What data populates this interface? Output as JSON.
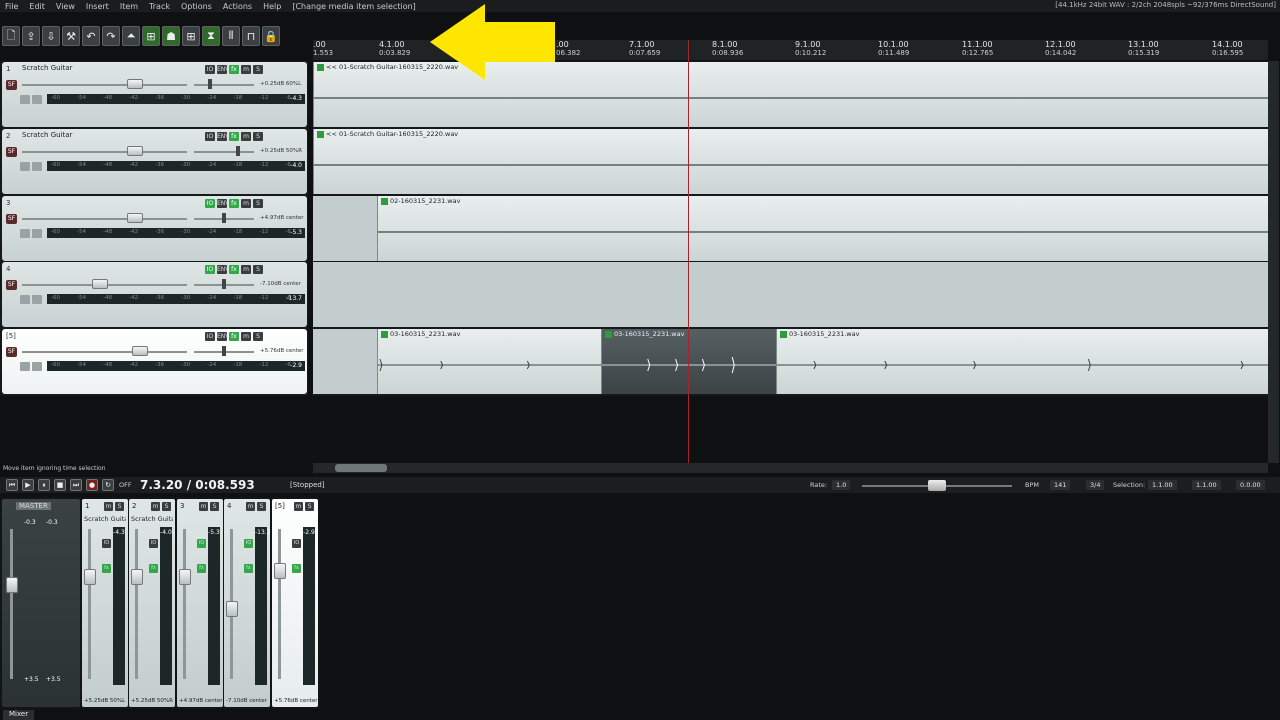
{
  "menu": [
    "File",
    "Edit",
    "View",
    "Insert",
    "Item",
    "Track",
    "Options",
    "Actions",
    "Help"
  ],
  "undo_hint": "[Change media item selection]",
  "audio_status": "[44.1kHz 24bit WAV : 2/2ch 2048spls ~92/376ms DirectSound]",
  "ruler": [
    {
      "bar": ".00",
      "time": "1.553"
    },
    {
      "bar": "4.1.00",
      "time": "0:03.829"
    },
    {
      "bar": ".00",
      "time": "06.382"
    },
    {
      "bar": "7.1.00",
      "time": "0:07.659"
    },
    {
      "bar": "8.1.00",
      "time": "0:08.936"
    },
    {
      "bar": "9.1.00",
      "time": "0:10.212"
    },
    {
      "bar": "10.1.00",
      "time": "0:11.489"
    },
    {
      "bar": "11.1.00",
      "time": "0:12.765"
    },
    {
      "bar": "12.1.00",
      "time": "0:14.042"
    },
    {
      "bar": "13.1.00",
      "time": "0:15.319"
    },
    {
      "bar": "14.1.00",
      "time": "0:16.595"
    }
  ],
  "tracks": [
    {
      "num": "1",
      "name": "Scratch Guitar",
      "vol": "+0.25dB 60%L",
      "peak": "-4.3"
    },
    {
      "num": "2",
      "name": "Scratch Guitar",
      "vol": "+0.25dB 50%R",
      "peak": "-4.0"
    },
    {
      "num": "3",
      "name": "",
      "vol": "+4.97dB center",
      "peak": "-5.3"
    },
    {
      "num": "4",
      "name": "",
      "vol": "-7.10dB center",
      "peak": "-13.7"
    },
    {
      "num": "[5]",
      "name": "",
      "vol": "+5.76dB center",
      "peak": "-2.9"
    }
  ],
  "meter_ticks": [
    "-60",
    "-54",
    "-48",
    "-42",
    "-36",
    "-30",
    "-24",
    "-18",
    "-12",
    "-6"
  ],
  "track_buttons": {
    "io": "IO",
    "env": "ENV",
    "fx": "fx",
    "mute": "m",
    "solo": "S",
    "rec": "SF"
  },
  "items": [
    {
      "label": "<< 01-Scratch Guitar-160315_2220.wav"
    },
    {
      "label": "<< 01-Scratch Guitar-160315_2220.wav"
    },
    {
      "label": "02-160315_2231.wav"
    },
    {
      "label": "03-160315_2231.wav"
    },
    {
      "label": "03-160315_2231.wav"
    },
    {
      "label": "03-160315_2231.wav"
    }
  ],
  "status_line": "Move item ignoring time selection",
  "transport": {
    "timecode": "7.3.20 / 0:08.593",
    "state": "[Stopped]",
    "off_label": "OFF",
    "rate_label": "Rate:",
    "rate": "1.0",
    "bpm_label": "BPM",
    "bpm": "141",
    "sig": "3/4",
    "selection_label": "Selection:",
    "sel_start": "1.1.00",
    "sel_end": "1.1.00",
    "sel_len": "0.0.00"
  },
  "mixer": {
    "master": {
      "name": "MASTER",
      "peak_l": "-0.3",
      "peak_r": "-0.3",
      "vol_l": "+3.5",
      "vol_r": "+3.5"
    },
    "strips": [
      {
        "num": "1",
        "name": "Scratch Guita",
        "peak": "-4.3",
        "pan": "+5.25dB 50%L"
      },
      {
        "num": "2",
        "name": "Scratch Guita",
        "peak": "-4.0",
        "pan": "+5.25dB 50%R"
      },
      {
        "num": "3",
        "name": "",
        "peak": "-5.3",
        "pan": "+4.97dB center"
      },
      {
        "num": "4",
        "name": "",
        "peak": "-13.7",
        "pan": "-7.10dB center"
      },
      {
        "num": "[5]",
        "name": "",
        "peak": "-2.9",
        "pan": "+5.76dB center"
      }
    ],
    "tab": "Mixer"
  },
  "colors": {
    "accent_green": "#32a84a",
    "play_cursor": "#a3262d",
    "arrow": "#ffe600"
  }
}
